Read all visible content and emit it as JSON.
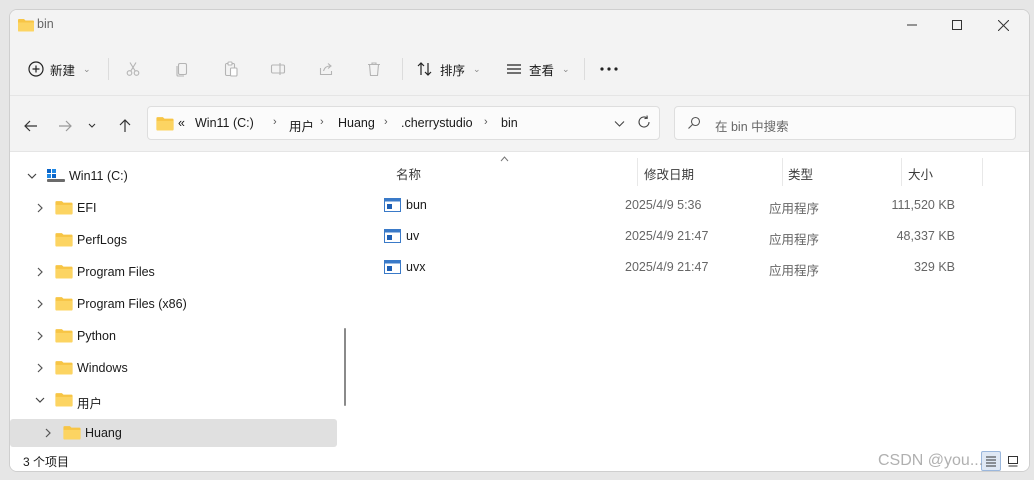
{
  "window": {
    "title": "bin"
  },
  "toolbar": {
    "new_label": "新建",
    "sort_label": "排序",
    "view_label": "查看"
  },
  "breadcrumb": {
    "overflow": "«",
    "items": [
      "Win11 (C:)",
      "用户",
      "Huang",
      ".cherrystudio",
      "bin"
    ]
  },
  "search": {
    "placeholder": "在 bin 中搜索"
  },
  "nav_tree": {
    "items": [
      {
        "label": "Win11 (C:)",
        "icon": "drive-icon",
        "state": "expanded"
      },
      {
        "label": "EFI",
        "icon": "folder-icon",
        "state": "collapsed"
      },
      {
        "label": "PerfLogs",
        "icon": "folder-icon",
        "state": "none"
      },
      {
        "label": "Program Files",
        "icon": "folder-icon",
        "state": "collapsed"
      },
      {
        "label": "Program Files (x86)",
        "icon": "folder-icon",
        "state": "collapsed"
      },
      {
        "label": "Python",
        "icon": "folder-icon",
        "state": "collapsed"
      },
      {
        "label": "Windows",
        "icon": "folder-icon",
        "state": "collapsed"
      },
      {
        "label": "用户",
        "icon": "folder-icon",
        "state": "expanded"
      },
      {
        "label": "Huang",
        "icon": "folder-icon",
        "state": "collapsed",
        "selected": true
      }
    ]
  },
  "file_list": {
    "columns": [
      "名称",
      "修改日期",
      "类型",
      "大小"
    ],
    "rows": [
      {
        "name": "bun",
        "modified": "2025/4/9 5:36",
        "type": "应用程序",
        "size": "111,520 KB"
      },
      {
        "name": "uv",
        "modified": "2025/4/9 21:47",
        "type": "应用程序",
        "size": "48,337 KB"
      },
      {
        "name": "uvx",
        "modified": "2025/4/9 21:47",
        "type": "应用程序",
        "size": "329 KB"
      }
    ]
  },
  "status": {
    "item_count": "3 个项目"
  },
  "watermark": "CSDN @you..."
}
